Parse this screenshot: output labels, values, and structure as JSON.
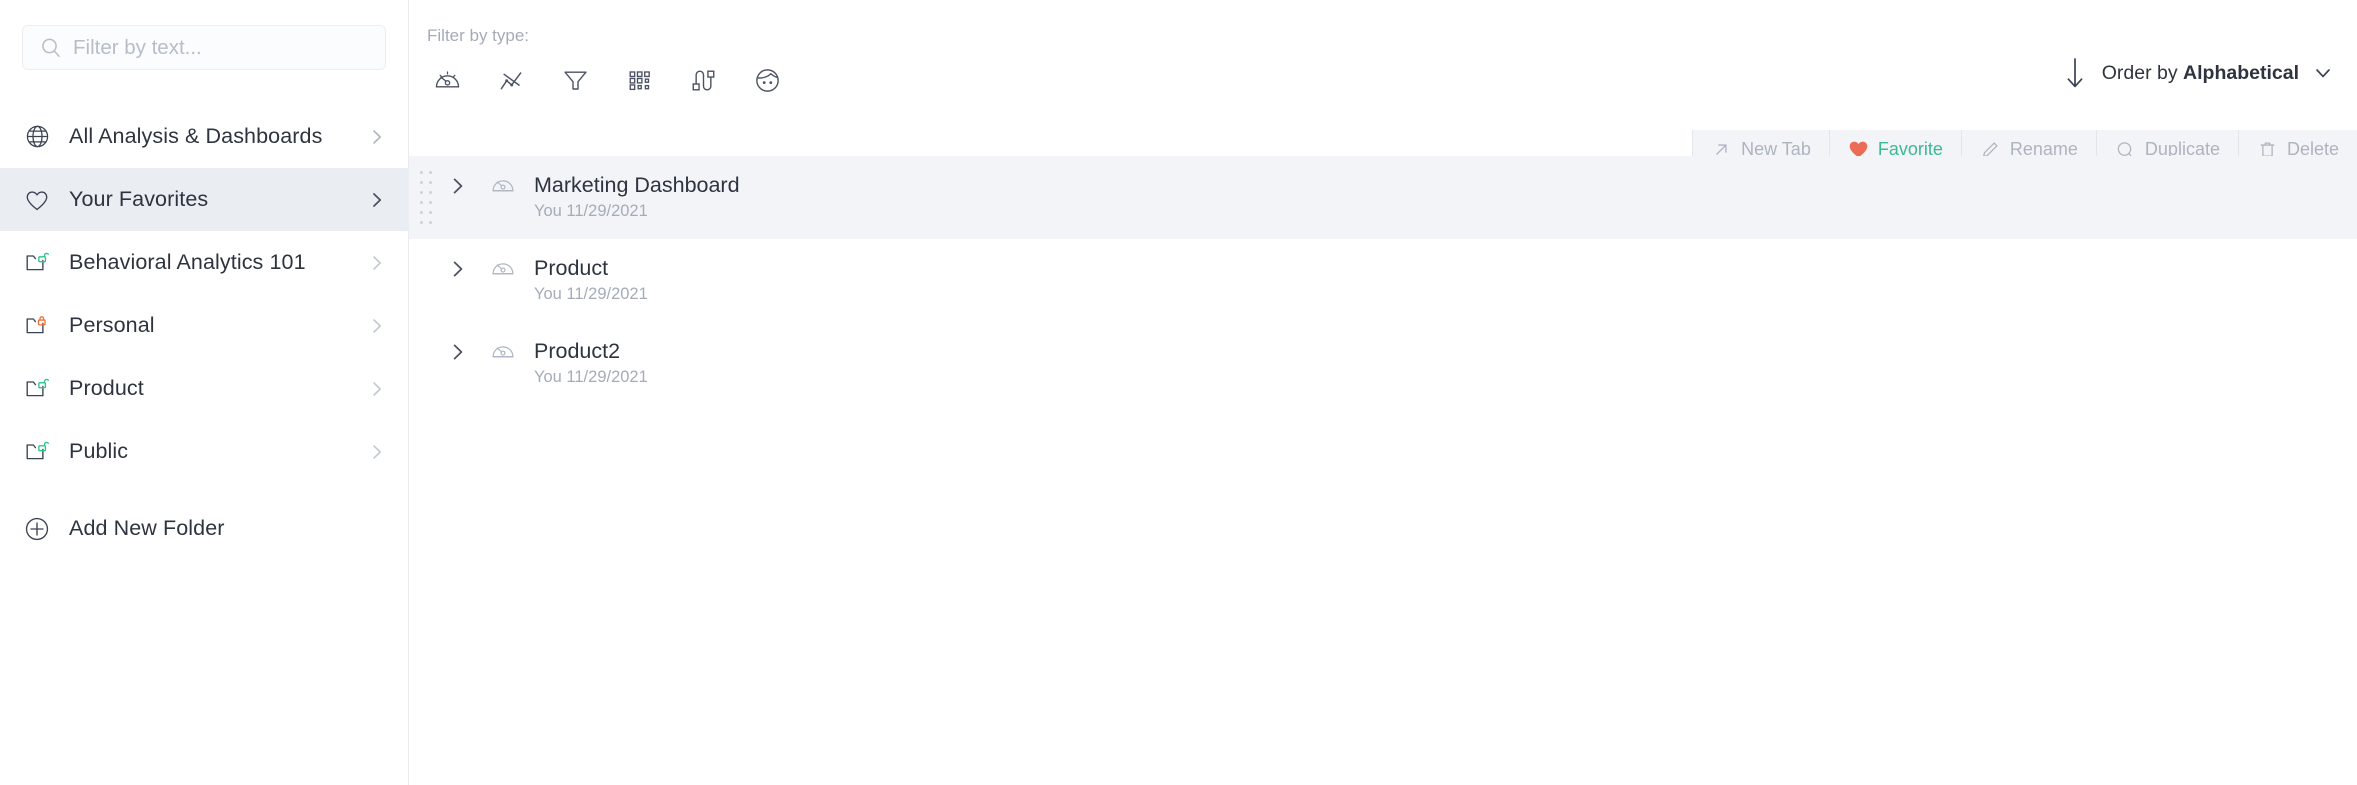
{
  "sidebar": {
    "search": {
      "placeholder": "Filter by text...",
      "value": "",
      "icon": "search-icon"
    },
    "items": [
      {
        "label": "All Analysis & Dashboards",
        "icon": "globe-icon",
        "selected": false,
        "chevron": "chevron-right-icon"
      },
      {
        "label": "Your Favorites",
        "icon": "heart-outline-icon",
        "selected": true,
        "chevron": "chevron-right-icon"
      },
      {
        "label": "Behavioral Analytics 101",
        "icon": "folder-unlocked-icon",
        "selected": false,
        "chevron": "chevron-right-icon"
      },
      {
        "label": "Personal",
        "icon": "folder-locked-icon",
        "selected": false,
        "chevron": "chevron-right-icon"
      },
      {
        "label": "Product",
        "icon": "folder-unlocked-icon",
        "selected": false,
        "chevron": "chevron-right-icon"
      },
      {
        "label": "Public",
        "icon": "folder-unlocked-icon",
        "selected": false,
        "chevron": "chevron-right-icon"
      },
      {
        "label": "Add New Folder",
        "icon": "plus-circle-icon",
        "selected": false,
        "chevron": ""
      }
    ]
  },
  "main": {
    "filter_by_type_label": "Filter by type:",
    "type_filters": [
      {
        "name": "dashboard-gauge-icon"
      },
      {
        "name": "line-chart-icon"
      },
      {
        "name": "funnel-icon"
      },
      {
        "name": "grid-table-icon"
      },
      {
        "name": "pathfinder-journey-icon"
      },
      {
        "name": "user-face-icon"
      }
    ],
    "order_by": {
      "prefix": "Order by ",
      "value": "Alphabetical",
      "direction_icon": "arrow-down-icon",
      "chevron_icon": "chevron-down-icon"
    },
    "row_actions": [
      {
        "label": "New Tab",
        "icon": "arrow-up-right-icon",
        "accent": false
      },
      {
        "label": "Favorite",
        "icon": "heart-filled-icon",
        "accent": true
      },
      {
        "label": "Rename",
        "icon": "pencil-icon",
        "accent": false
      },
      {
        "label": "Duplicate",
        "icon": "duplicate-icon",
        "accent": false
      },
      {
        "label": "Delete",
        "icon": "trash-icon",
        "accent": false
      }
    ],
    "list": [
      {
        "title": "Marketing Dashboard",
        "meta": "You 11/29/2021",
        "icon": "dashboard-gauge-icon",
        "chevron": "chevron-right-icon",
        "active": true
      },
      {
        "title": "Product",
        "meta": "You 11/29/2021",
        "icon": "dashboard-gauge-icon",
        "chevron": "chevron-right-icon",
        "active": false
      },
      {
        "title": "Product2",
        "meta": "You 11/29/2021",
        "icon": "dashboard-gauge-icon",
        "chevron": "chevron-right-icon",
        "active": false
      }
    ]
  },
  "colors": {
    "accent_green": "#3bb896",
    "accent_coral": "#ec6b56",
    "lock_orange": "#f4713a",
    "lock_green": "#2ec48f",
    "row_highlight": "#f2f4f8",
    "sidebar_selected": "#eaedf2",
    "text_primary": "#2e343f",
    "text_muted": "#a5acb8"
  }
}
